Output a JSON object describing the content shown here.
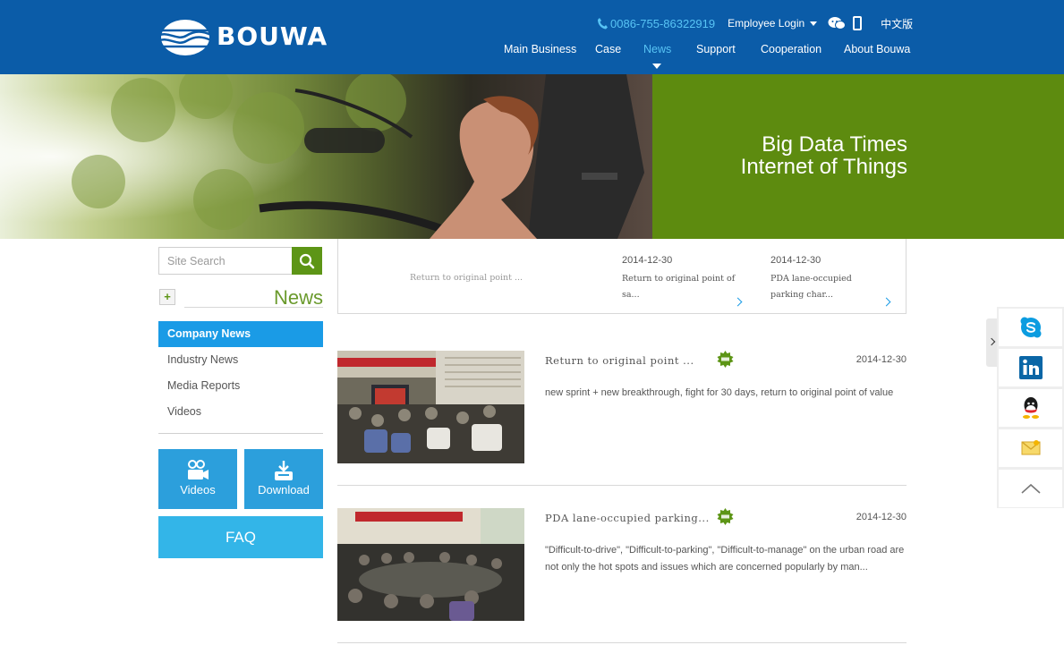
{
  "brand": {
    "name": "BOUWA"
  },
  "topbar": {
    "phone": "0086-755-86322919",
    "employee_login": "Employee Login",
    "language": "中文版"
  },
  "nav": {
    "items": [
      {
        "label": "Main Business"
      },
      {
        "label": "Case"
      },
      {
        "label": "News"
      },
      {
        "label": "Support"
      },
      {
        "label": "Cooperation"
      },
      {
        "label": "About Bouwa"
      }
    ],
    "active": "News"
  },
  "banner": {
    "line1": "Big Data Times",
    "line2": "Internet of Things"
  },
  "sidebar": {
    "search_placeholder": "Site Search",
    "section_title": "News",
    "menu": [
      {
        "label": "Company News"
      },
      {
        "label": "Industry News"
      },
      {
        "label": "Media Reports"
      },
      {
        "label": "Videos"
      }
    ],
    "active_menu": "Company News",
    "tiles": {
      "videos": "Videos",
      "download": "Download"
    },
    "faq": "FAQ"
  },
  "featured": {
    "first_title": "Return to original point ...",
    "cards": [
      {
        "date": "2014-12-30",
        "title": "Return to original point of sa..."
      },
      {
        "date": "2014-12-30",
        "title": "PDA lane-occupied parking char..."
      }
    ]
  },
  "news": [
    {
      "title": "Return to original point ...",
      "date": "2014-12-30",
      "desc": "new sprint + new breakthrough, fight for 30 days, return to original point of value"
    },
    {
      "title": "PDA lane-occupied parking...",
      "date": "2014-12-30",
      "desc": "\"Difficult-to-drive\", \"Difficult-to-parking\", \"Difficult-to-manage\" on the urban road are not only the hot spots and issues which are concerned popularly by man..."
    }
  ],
  "colors": {
    "header_bg": "#0b5ca8",
    "accent_blue": "#1a9be6",
    "brand_green": "#5d8b0f",
    "link_cyan": "#58c4f5"
  },
  "icons": {
    "float_bar": [
      "skype-icon",
      "linkedin-icon",
      "qq-icon",
      "message-icon",
      "back-to-top-icon"
    ]
  }
}
